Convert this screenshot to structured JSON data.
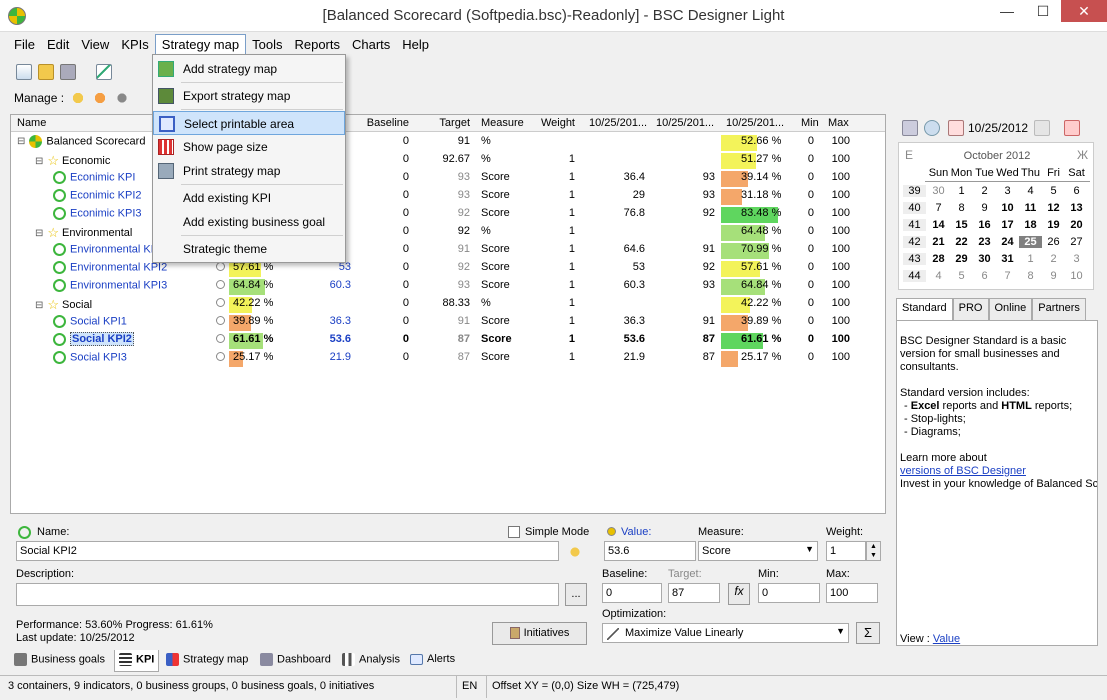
{
  "window": {
    "title": "[Balanced Scorecard (Softpedia.bsc)-Readonly] - BSC Designer Light",
    "controls": [
      "—",
      "☐",
      "✕"
    ]
  },
  "menubar": [
    "File",
    "Edit",
    "View",
    "KPIs",
    "Strategy map",
    "Tools",
    "Reports",
    "Charts",
    "Help"
  ],
  "toolbar": {
    "manage_label": "Manage :"
  },
  "strategy_menu": [
    {
      "label": "Add strategy map"
    },
    {
      "label": "Export strategy map"
    },
    {
      "label": "Select printable area"
    },
    {
      "label": "Show page size"
    },
    {
      "label": "Print strategy map"
    },
    {
      "label": "Add existing KPI"
    },
    {
      "label": "Add existing business goal"
    },
    {
      "label": "Strategic theme"
    }
  ],
  "grid": {
    "headers": {
      "name": "Name",
      "baseline": "Baseline",
      "target": "Target",
      "measure": "Measure",
      "weight": "Weight",
      "d1": "10/25/201...",
      "d2": "10/25/201...",
      "d3": "10/25/201...",
      "min": "Min",
      "max": "Max"
    },
    "rows": [
      {
        "name": "Balanced Scorecard",
        "pct": "",
        "val": "",
        "base": "0",
        "tgt": "91",
        "meas": "%",
        "wt": "",
        "v1": "",
        "v2": "",
        "prog": "52.66 %",
        "progv": 52.66,
        "color": "#f3f35a",
        "min": "0",
        "max": "100"
      },
      {
        "name": "Economic",
        "pct": "",
        "val": "",
        "base": "0",
        "tgt": "92.67",
        "meas": "%",
        "wt": "1",
        "v1": "",
        "v2": "",
        "prog": "51.27 %",
        "progv": 51.27,
        "color": "#f3f35a",
        "min": "0",
        "max": "100"
      },
      {
        "name": "Econimic KPI",
        "pct": "",
        "val": "",
        "base": "0",
        "tgt": "93",
        "meas": "Score",
        "wt": "1",
        "v1": "36.4",
        "v2": "93",
        "prog": "39.14 %",
        "progv": 39.14,
        "color": "#f4a76a",
        "min": "0",
        "max": "100"
      },
      {
        "name": "Econimic KPI2",
        "pct": "",
        "val": "",
        "base": "0",
        "tgt": "93",
        "meas": "Score",
        "wt": "1",
        "v1": "29",
        "v2": "93",
        "prog": "31.18 %",
        "progv": 31.18,
        "color": "#f4a76a",
        "min": "0",
        "max": "100"
      },
      {
        "name": "Econimic KPI3",
        "pct": "",
        "val": "",
        "base": "0",
        "tgt": "92",
        "meas": "Score",
        "wt": "1",
        "v1": "76.8",
        "v2": "92",
        "prog": "83.48 %",
        "progv": 83.48,
        "color": "#5fd65f",
        "min": "0",
        "max": "100"
      },
      {
        "name": "Environmental",
        "pct": "",
        "val": "",
        "base": "0",
        "tgt": "92",
        "meas": "%",
        "wt": "1",
        "v1": "",
        "v2": "",
        "prog": "64.48 %",
        "progv": 64.48,
        "color": "#a6e07a",
        "min": "0",
        "max": "100"
      },
      {
        "name": "Environmental KPI",
        "pct": "",
        "val": "",
        "base": "0",
        "tgt": "91",
        "meas": "Score",
        "wt": "1",
        "v1": "64.6",
        "v2": "91",
        "prog": "70.99 %",
        "progv": 70.99,
        "color": "#a6e07a",
        "min": "0",
        "max": "100"
      },
      {
        "name": "Environmental KPI2",
        "pct": "57.61 %",
        "pctv": 57.61,
        "pctc": "#f3f35a",
        "val": "53",
        "base": "0",
        "tgt": "92",
        "meas": "Score",
        "wt": "1",
        "v1": "53",
        "v2": "92",
        "prog": "57.61 %",
        "progv": 57.61,
        "color": "#f3f35a",
        "min": "0",
        "max": "100"
      },
      {
        "name": "Environmental KPI3",
        "pct": "64.84 %",
        "pctv": 64.84,
        "pctc": "#a6e07a",
        "val": "60.3",
        "base": "0",
        "tgt": "93",
        "meas": "Score",
        "wt": "1",
        "v1": "60.3",
        "v2": "93",
        "prog": "64.84 %",
        "progv": 64.84,
        "color": "#a6e07a",
        "min": "0",
        "max": "100"
      },
      {
        "name": "Social",
        "pct": "42.22 %",
        "pctv": 42.22,
        "pctc": "#f3f35a",
        "val": "",
        "base": "0",
        "tgt": "88.33",
        "meas": "%",
        "wt": "1",
        "v1": "",
        "v2": "",
        "prog": "42.22 %",
        "progv": 42.22,
        "color": "#f3f35a",
        "min": "0",
        "max": "100"
      },
      {
        "name": "Social KPI1",
        "pct": "39.89 %",
        "pctv": 39.89,
        "pctc": "#f4a76a",
        "val": "36.3",
        "base": "0",
        "tgt": "91",
        "meas": "Score",
        "wt": "1",
        "v1": "36.3",
        "v2": "91",
        "prog": "39.89 %",
        "progv": 39.89,
        "color": "#f4a76a",
        "min": "0",
        "max": "100"
      },
      {
        "name": "Social KPI2",
        "pct": "61.61 %",
        "pctv": 61.61,
        "pctc": "#a6e07a",
        "val": "53.6",
        "base": "0",
        "tgt": "87",
        "meas": "Score",
        "wt": "1",
        "v1": "53.6",
        "v2": "87",
        "prog": "61.61 %",
        "progv": 61.61,
        "color": "#5fd65f",
        "min": "0",
        "max": "100"
      },
      {
        "name": "Social KPI3",
        "pct": "25.17 %",
        "pctv": 25.17,
        "pctc": "#f4a76a",
        "val": "21.9",
        "base": "0",
        "tgt": "87",
        "meas": "Score",
        "wt": "1",
        "v1": "21.9",
        "v2": "87",
        "prog": "25.17 %",
        "progv": 25.17,
        "color": "#f4a76a",
        "min": "0",
        "max": "100"
      }
    ]
  },
  "calendar": {
    "date_field": "10/25/2012",
    "month": "October 2012",
    "prev": "E",
    "next": "Ж",
    "days": [
      "Sun",
      "Mon",
      "Tue",
      "Wed",
      "Thu",
      "Fri",
      "Sat"
    ],
    "weeks": [
      [
        "39",
        "30",
        "1",
        "2",
        "3",
        "4",
        "5",
        "6"
      ],
      [
        "40",
        "7",
        "8",
        "9",
        "10",
        "11",
        "12",
        "13"
      ],
      [
        "41",
        "14",
        "15",
        "16",
        "17",
        "18",
        "19",
        "20"
      ],
      [
        "42",
        "21",
        "22",
        "23",
        "24",
        "25",
        "26",
        "27"
      ],
      [
        "43",
        "28",
        "29",
        "30",
        "31",
        "1",
        "2",
        "3"
      ],
      [
        "44",
        "4",
        "5",
        "6",
        "7",
        "8",
        "9",
        "10"
      ]
    ]
  },
  "info_tabs": [
    "Standard",
    "PRO",
    "Online",
    "Partners"
  ],
  "info": {
    "p1": "BSC Designer Standard is a basic version for small businesses and consultants.",
    "p2": "Standard version includes:",
    "b1a": "- ",
    "b1b": "Excel",
    "b1c": " reports and ",
    "b1d": "HTML",
    "b1e": " reports;",
    "b2": "- Stop-lights;",
    "b3": "- Diagrams;",
    "p3": "Learn more about",
    "link": "versions of BSC Designer",
    "p4": "Invest in your knowledge of Balanced Sc",
    "view_label": "View :",
    "view_link": "Value"
  },
  "detail": {
    "name_label": "Name:",
    "name_value": "Social KPI2",
    "simple_mode": "Simple Mode",
    "description_label": "Description:",
    "description_value": "",
    "performance": "Performance: 53.60% Progress: 61.61%",
    "last_update": "Last update: 10/25/2012",
    "initiatives": "Initiatives",
    "value_label": "Value:",
    "value": "53.6",
    "measure_label": "Measure:",
    "measure": "Score",
    "weight_label": "Weight:",
    "weight": "1",
    "baseline_label": "Baseline:",
    "baseline": "0",
    "target_label": "Target:",
    "target": "87",
    "min_label": "Min:",
    "min": "0",
    "max_label": "Max:",
    "max": "100",
    "optimization_label": "Optimization:",
    "optimization": "Maximize Value Linearly",
    "dots": "..."
  },
  "bottom_tabs": [
    "Business goals",
    "KPI",
    "Strategy map",
    "Dashboard",
    "Analysis",
    "Alerts"
  ],
  "status": {
    "left": "3 containers, 9 indicators, 0 business groups, 0 business goals, 0 initiatives",
    "lang": "EN",
    "offset": "Offset XY = (0,0) Size WH = (725,479)"
  }
}
